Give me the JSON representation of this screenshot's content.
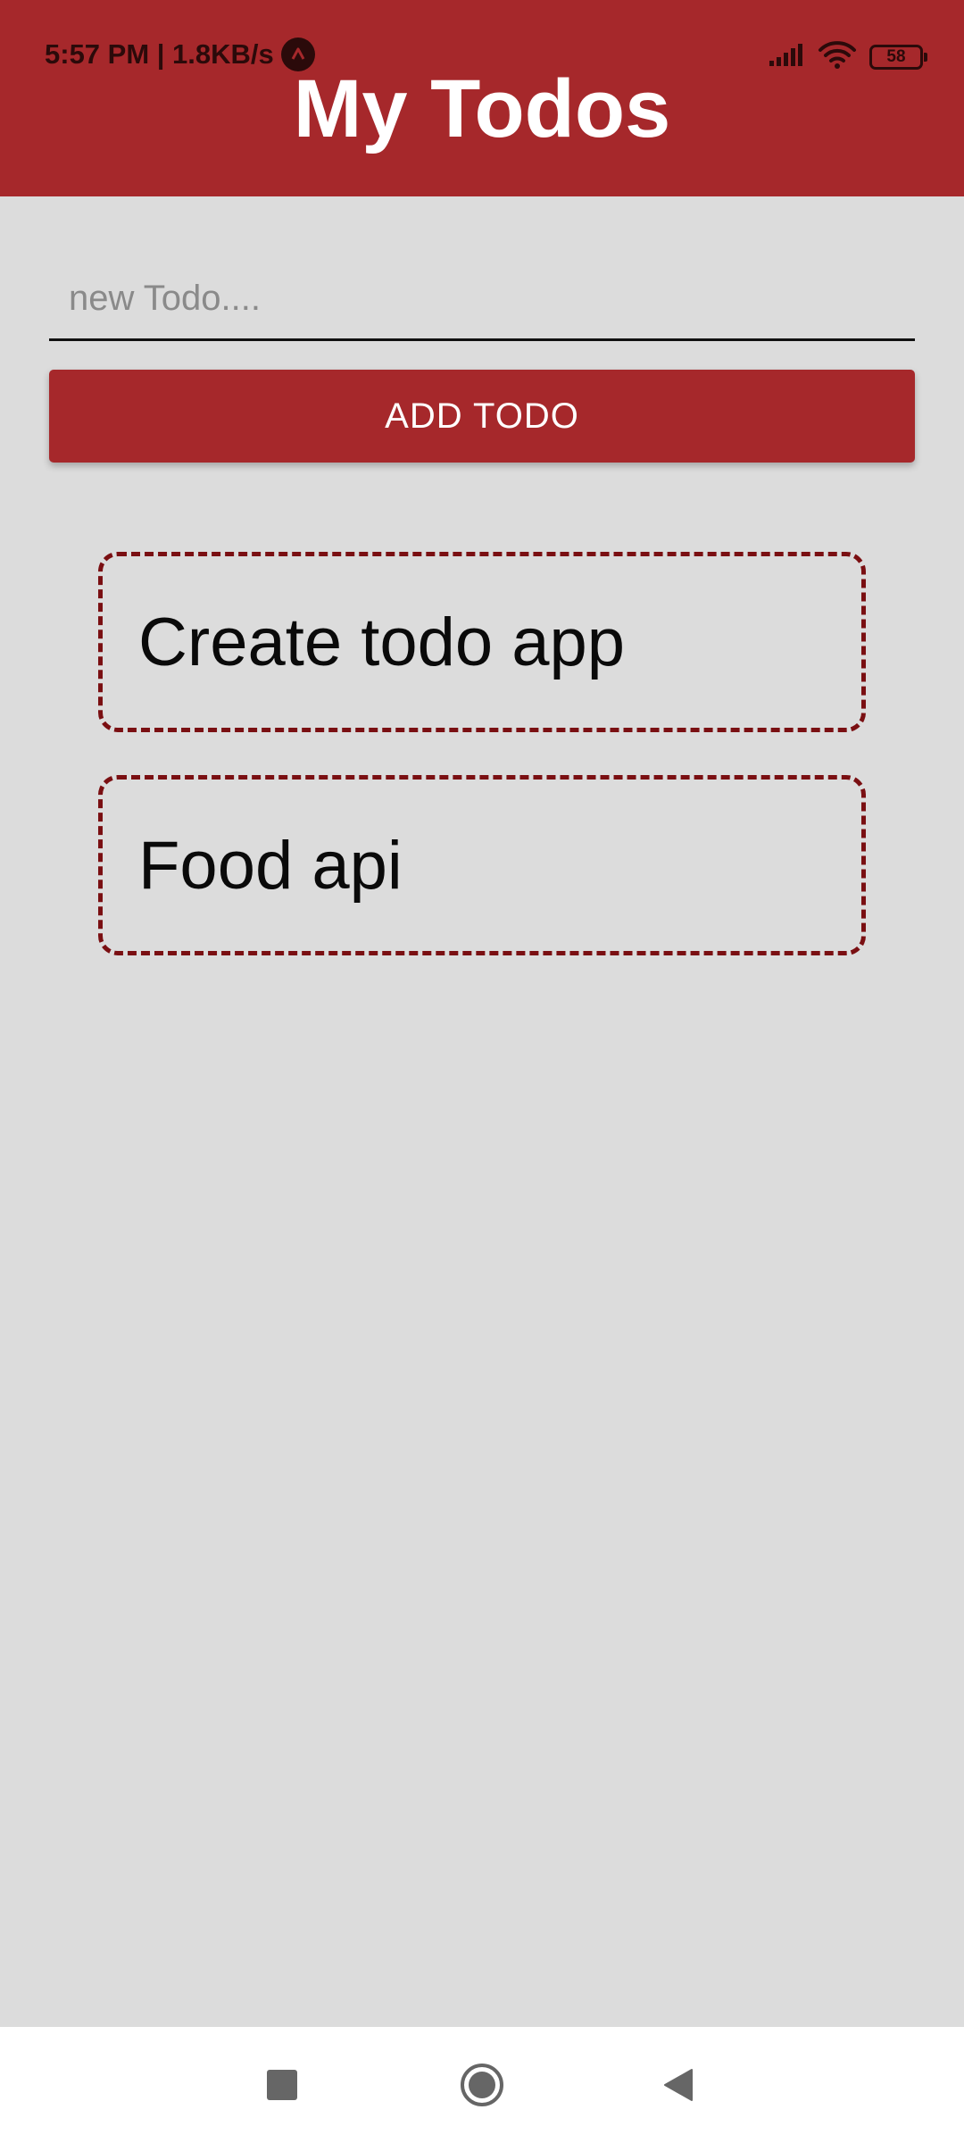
{
  "status_bar": {
    "time_speed": "5:57 PM | 1.8KB/s",
    "battery": "58"
  },
  "header": {
    "title": "My Todos",
    "color": "#a6282b"
  },
  "form": {
    "placeholder": "new Todo....",
    "value": "",
    "add_label": "ADD TODO"
  },
  "todos": [
    {
      "text": "Create todo app"
    },
    {
      "text": "Food api"
    }
  ],
  "nav": {
    "icons": [
      "recents-square-icon",
      "home-circle-icon",
      "back-triangle-icon"
    ]
  }
}
